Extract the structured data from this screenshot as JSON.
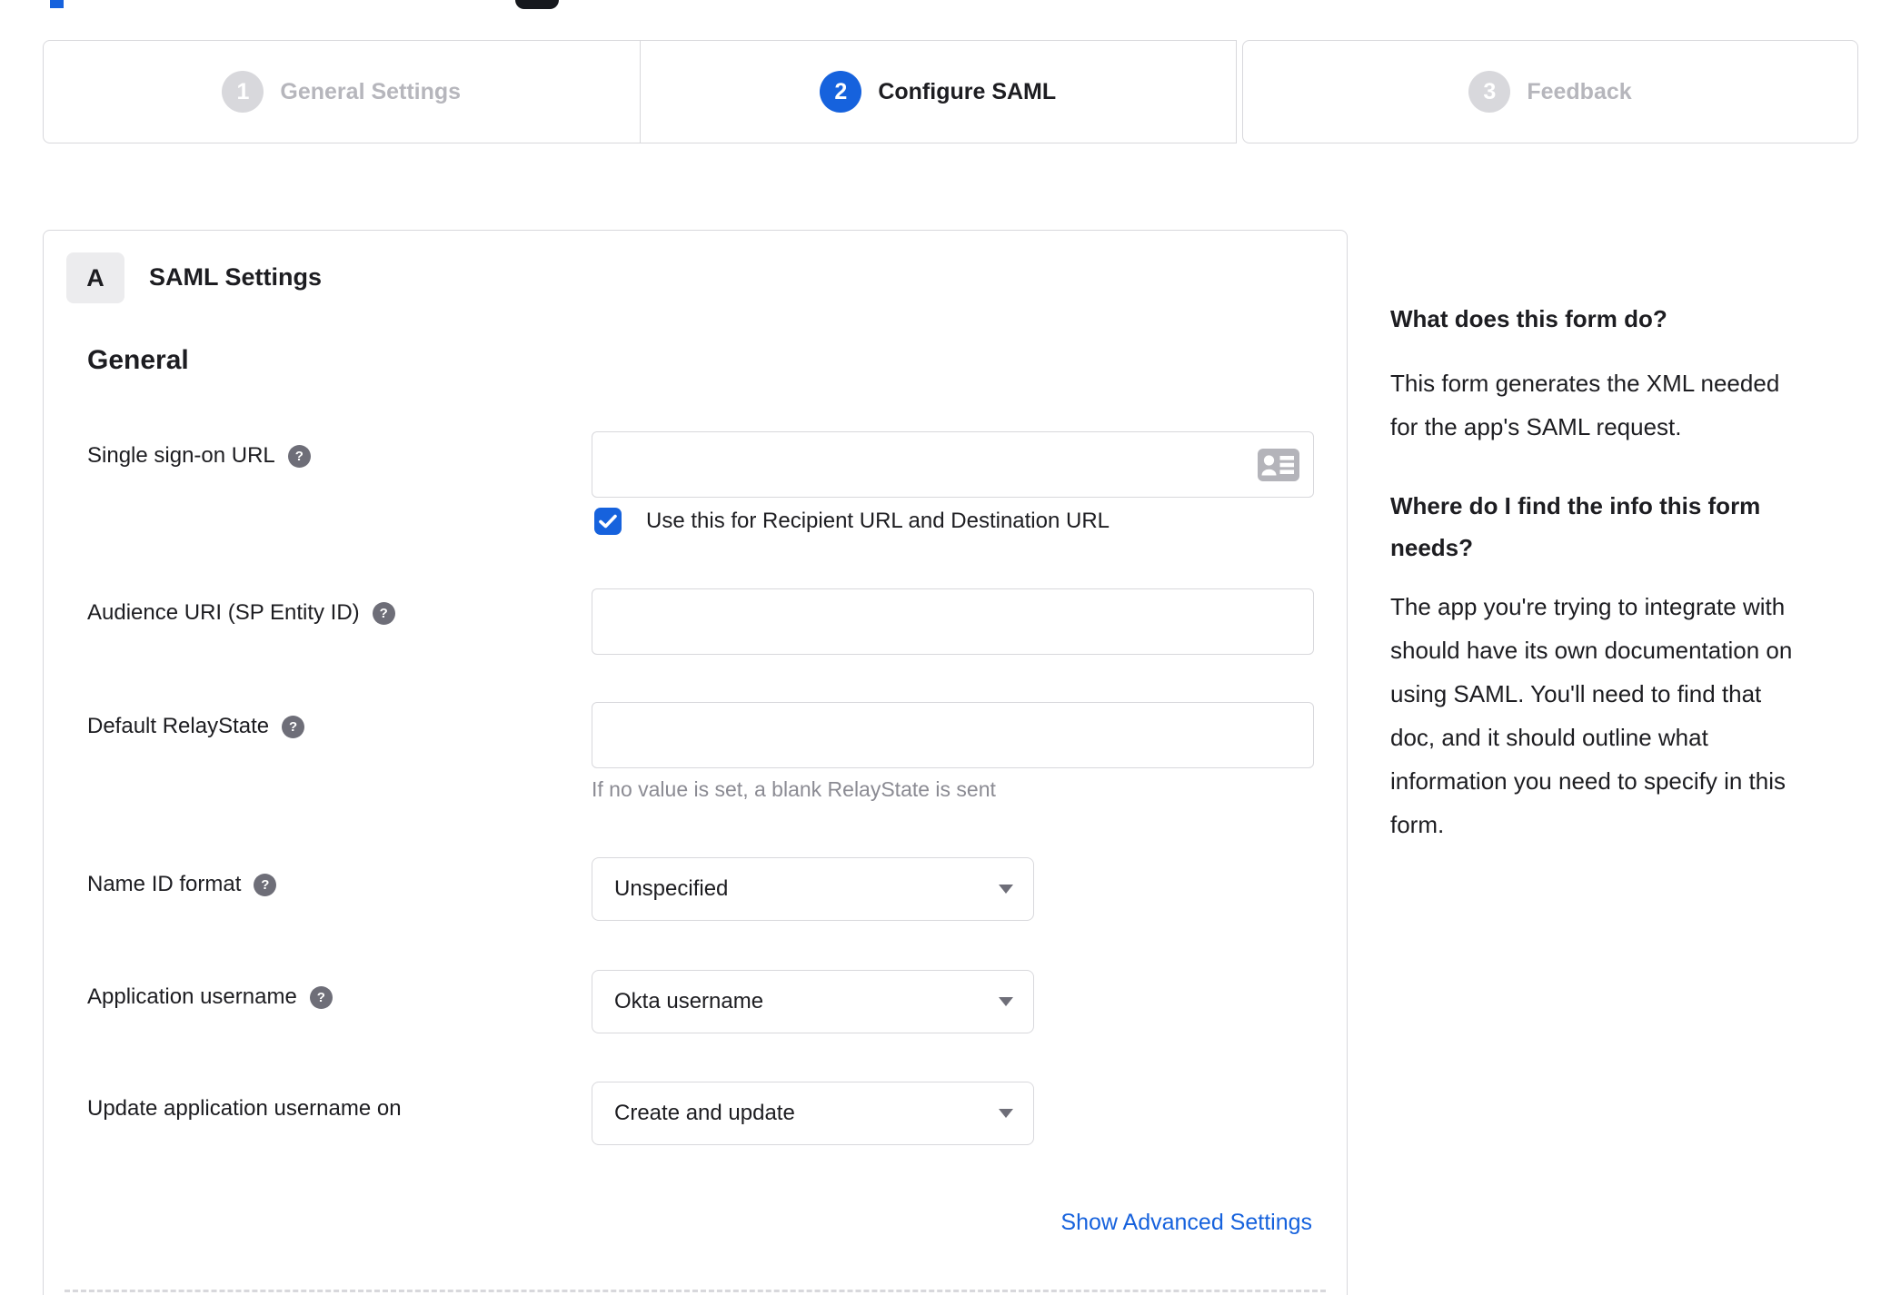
{
  "stepper": {
    "steps": [
      {
        "number": "1",
        "label": "General Settings",
        "state": "inactive"
      },
      {
        "number": "2",
        "label": "Configure SAML",
        "state": "active"
      },
      {
        "number": "3",
        "label": "Feedback",
        "state": "inactive"
      }
    ]
  },
  "panel": {
    "badge": "A",
    "title": "SAML Settings",
    "group_heading": "General",
    "rows": {
      "sso": {
        "label": "Single sign-on URL",
        "value": "",
        "has_help": true,
        "checkbox_checked": true,
        "checkbox_label": "Use this for Recipient URL and Destination URL"
      },
      "audience": {
        "label": "Audience URI (SP Entity ID)",
        "value": "",
        "has_help": true
      },
      "relay": {
        "label": "Default RelayState",
        "value": "",
        "has_help": true,
        "hint": "If no value is set, a blank RelayState is sent"
      },
      "nameid": {
        "label": "Name ID format",
        "value": "Unspecified",
        "has_help": true
      },
      "appuser": {
        "label": "Application username",
        "value": "Okta username",
        "has_help": true
      },
      "update": {
        "label": "Update application username on",
        "value": "Create and update",
        "has_help": false
      }
    },
    "advanced_link": "Show Advanced Settings"
  },
  "sidebar": {
    "q1": "What does this form do?",
    "a1": "This form generates the XML needed for the app's SAML request.",
    "a1_lines": [
      "This form generates the XML needed",
      "for the app's SAML request."
    ],
    "q2": "Where do I find the info this form needs?",
    "q2_lines": [
      "Where do I find the info this form",
      "needs?"
    ],
    "a2": "The app you're trying to integrate with should have its own documentation on using SAML. You'll need to find that doc, and it should outline what information you need to specify in this form.",
    "a2_lines": [
      "The app you're trying to integrate with",
      "should have its own documentation on",
      "using SAML. You'll need to find that",
      "doc, and it should outline what",
      "information you need to specify in this",
      "form."
    ]
  },
  "icons": {
    "help": "?",
    "check": "checkmark",
    "card": "contact-card",
    "caret": "caret-down"
  },
  "colors": {
    "accent_blue": "#1662dd",
    "step_inactive": "#d8d8dc",
    "text": "#1d1d21",
    "muted_text": "#8b8b93",
    "border": "#d8d8dc",
    "help_icon": "#6e6e78",
    "badge_bg": "#ececee"
  }
}
